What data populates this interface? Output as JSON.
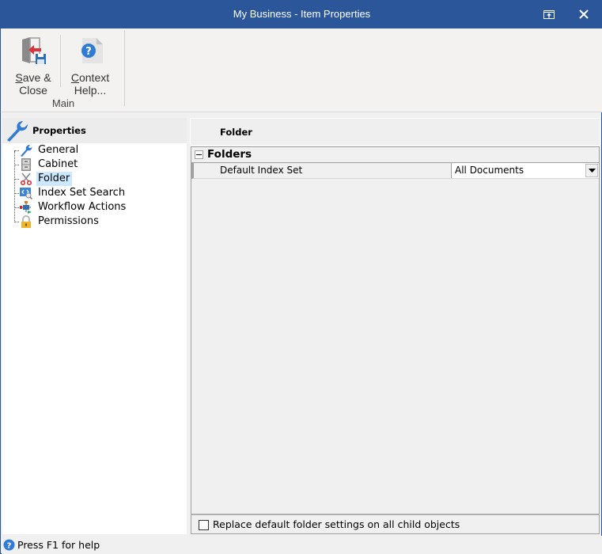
{
  "window": {
    "title": "My Business - Item Properties",
    "restore_icon": "restore-window-icon",
    "close_icon": "close-icon"
  },
  "ribbon": {
    "buttons": [
      {
        "label_line1_ul": "S",
        "label_line1": "ave &",
        "label_line2": "Close",
        "icon": "save-close-icon"
      },
      {
        "label_line1_ul": "C",
        "label_line1": "ontext",
        "label_line2": "Help...",
        "icon": "context-help-icon"
      }
    ],
    "group_label": "Main"
  },
  "left_panel": {
    "header": "Properties",
    "header_icon": "wrench-icon",
    "items": [
      {
        "label": "General",
        "icon": "wrench-icon",
        "selected": false
      },
      {
        "label": "Cabinet",
        "icon": "cabinet-icon",
        "selected": false
      },
      {
        "label": "Folder",
        "icon": "scissors-icon",
        "selected": true
      },
      {
        "label": "Index Set Search",
        "icon": "index-search-icon",
        "selected": false
      },
      {
        "label": "Workflow Actions",
        "icon": "workflow-icon",
        "selected": false
      },
      {
        "label": "Permissions",
        "icon": "lock-icon",
        "selected": false
      }
    ]
  },
  "right_panel": {
    "header": "Folder",
    "category": {
      "label": "Folders",
      "toggle": "−"
    },
    "properties": [
      {
        "name": "Default Index Set",
        "value": "All Documents"
      }
    ],
    "footer_checkbox": {
      "label": "Replace default folder settings on all child objects",
      "checked": false
    }
  },
  "statusbar": {
    "text": "Press F1 for help",
    "icon": "help-icon"
  },
  "colors": {
    "titlebar": "#2b579a",
    "selection": "#cce8ff"
  }
}
